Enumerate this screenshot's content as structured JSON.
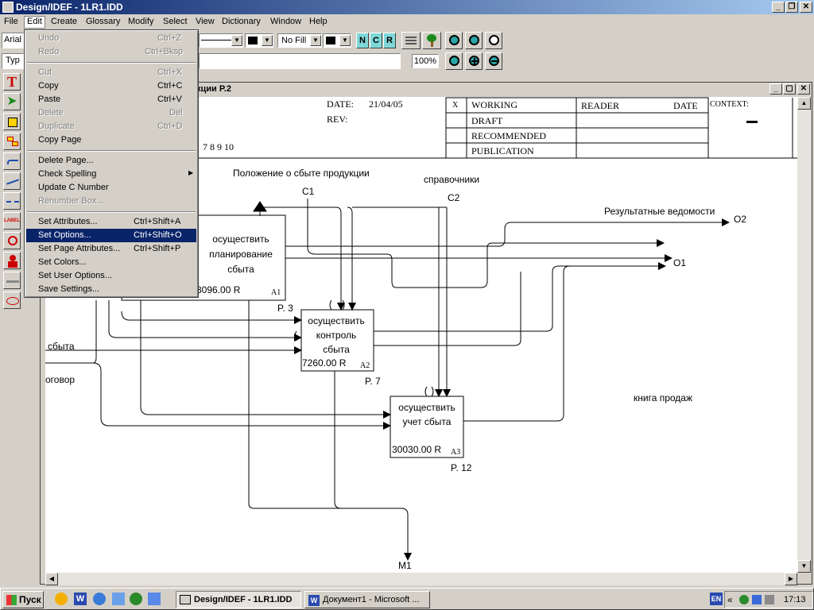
{
  "window": {
    "title": "Design/IDEF - 1LR1.IDD"
  },
  "menubar": {
    "items": [
      "File",
      "Edit",
      "Create",
      "Glossary",
      "Modify",
      "Select",
      "View",
      "Dictionary",
      "Window",
      "Help"
    ]
  },
  "toolbar": {
    "font": "Arial",
    "fill": "No Fill",
    "type_label": "Typ",
    "zoom": "100%"
  },
  "edit_menu": {
    "items": [
      {
        "label": "Undo",
        "shortcut": "Ctrl+Z",
        "disabled": true
      },
      {
        "label": "Redo",
        "shortcut": "Ctrl+Bksp",
        "disabled": true
      },
      {
        "label": "Cut",
        "shortcut": "Ctrl+X",
        "disabled": true
      },
      {
        "label": "Copy",
        "shortcut": "Ctrl+C",
        "disabled": false
      },
      {
        "label": "Paste",
        "shortcut": "Ctrl+V",
        "disabled": false
      },
      {
        "label": "Delete",
        "shortcut": "Del",
        "disabled": true
      },
      {
        "label": "Duplicate",
        "shortcut": "Ctrl+D",
        "disabled": true
      },
      {
        "label": "Copy Page",
        "shortcut": "",
        "disabled": false
      },
      {
        "label": "Delete Page...",
        "shortcut": "",
        "disabled": false
      },
      {
        "label": "Check Spelling",
        "shortcut": "",
        "disabled": false,
        "submenu": true
      },
      {
        "label": "Update C Number",
        "shortcut": "",
        "disabled": false
      },
      {
        "label": "Renumber Box...",
        "shortcut": "",
        "disabled": true
      },
      {
        "label": "Set Attributes...",
        "shortcut": "Ctrl+Shift+A",
        "disabled": false
      },
      {
        "label": "Set Options...",
        "shortcut": "Ctrl+Shift+O",
        "disabled": false,
        "selected": true
      },
      {
        "label": "Set Page Attributes...",
        "shortcut": "Ctrl+Shift+P",
        "disabled": false
      },
      {
        "label": "Set Colors...",
        "shortcut": "",
        "disabled": false
      },
      {
        "label": "Set User Options...",
        "shortcut": "",
        "disabled": false
      },
      {
        "label": "Save Settings...",
        "shortcut": "",
        "disabled": false
      }
    ]
  },
  "document": {
    "title": "кции P.2"
  },
  "header": {
    "date_label": "DATE:",
    "date_value": "21/04/05",
    "rev_label": "REV:",
    "page_nums": "7 8 9 10",
    "x_mark": "X",
    "status": [
      "WORKING",
      "DRAFT",
      "RECOMMENDED",
      "PUBLICATION"
    ],
    "reader": "READER",
    "date2": "DATE",
    "context": "CONTEXT:"
  },
  "diagram": {
    "labels": {
      "c1_text": "Положение о сбыте продукции",
      "c1": "C1",
      "c2_text": "справочники",
      "c2": "C2",
      "o2_text": "Результатные ведомости",
      "o2": "O2",
      "o1": "O1",
      "m1": "M1",
      "in1": "сбыта",
      "in2": "оговор",
      "kniga": "книга продаж"
    },
    "boxes": [
      {
        "text": [
          "осуществить",
          "планирование",
          "сбыта"
        ],
        "cost": "3096.00 R",
        "id": "A1",
        "ref": "P. 3"
      },
      {
        "text": [
          "осуществить",
          "контроль",
          "сбыта"
        ],
        "cost": "7260.00 R",
        "id": "A2",
        "ref": "P. 7"
      },
      {
        "text": [
          "осуществить",
          "учет сбыта"
        ],
        "cost": "30030.00 R",
        "id": "A3",
        "ref": "P. 12"
      }
    ]
  },
  "taskbar": {
    "start": "Пуск",
    "tasks": [
      "Design/IDEF - 1LR1.IDD",
      "Документ1 - Microsoft ..."
    ],
    "lang": "EN",
    "clock": "17:13"
  },
  "colors": {
    "titlebar": "#0a246a",
    "menu_selected": "#0a246a",
    "desktop": "#d4d0c8"
  }
}
